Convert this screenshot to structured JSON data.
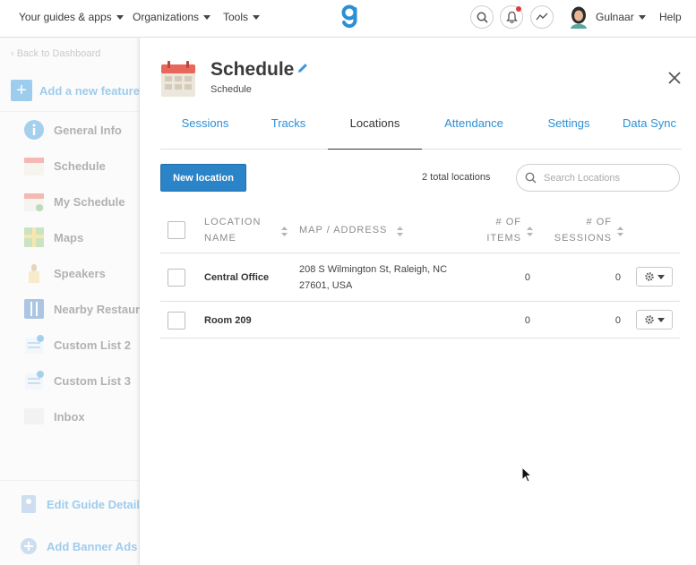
{
  "topbar": {
    "menus": [
      "Your guides & apps",
      "Organizations",
      "Tools"
    ],
    "user_name": "Gulnaar",
    "help_label": "Help"
  },
  "sidebar": {
    "back_link": "‹ Back to Dashboard",
    "add_feature": "Add a new feature",
    "items": [
      "General Info",
      "Schedule",
      "My Schedule",
      "Maps",
      "Speakers",
      "Nearby Restaurants",
      "Custom List 2",
      "Custom List 3",
      "Inbox"
    ],
    "bottom_items": [
      "Edit Guide Details",
      "Add Banner Ads"
    ]
  },
  "panel": {
    "title": "Schedule",
    "subtitle": "Schedule",
    "tabs": [
      "Sessions",
      "Tracks",
      "Locations",
      "Attendance",
      "Settings",
      "Data Sync"
    ],
    "active_tab": "Locations",
    "new_button": "New location",
    "total_count": "2 total locations",
    "search_placeholder": "Search Locations"
  },
  "table": {
    "headers": {
      "name_line1": "LOCATION",
      "name_line2": "NAME",
      "address": "MAP / ADDRESS",
      "items_line1": "# OF",
      "items_line2": "ITEMS",
      "sessions_line1": "# OF",
      "sessions_line2": "SESSIONS"
    },
    "rows": [
      {
        "name": "Central Office",
        "address_line1": "208 S Wilmington St, Raleigh, NC",
        "address_line2": "27601, USA",
        "items": "0",
        "sessions": "0"
      },
      {
        "name": "Room 209",
        "address_line1": "",
        "address_line2": "",
        "items": "0",
        "sessions": "0"
      }
    ]
  },
  "colors": {
    "accent": "#2b8fd6",
    "button": "#2b84c8",
    "notification": "#e0393e",
    "calendar_red": "#e8665a"
  }
}
